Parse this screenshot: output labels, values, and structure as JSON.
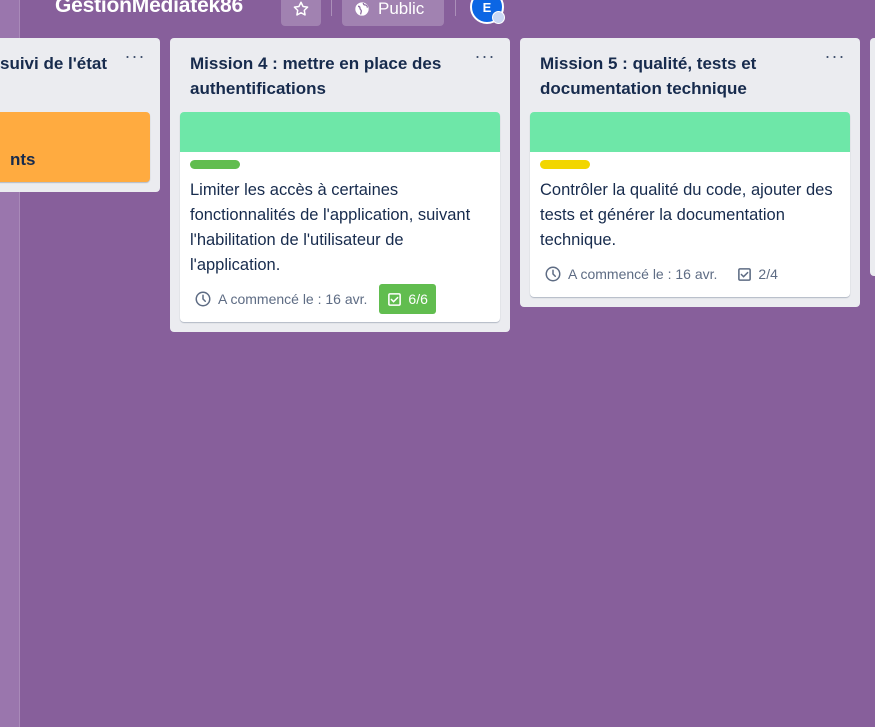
{
  "board": {
    "title": "GestionMediatek86",
    "visibility_label": "Public",
    "avatar_initial": "E"
  },
  "lists": [
    {
      "title": "suivi de l'état",
      "menu": "···",
      "cards": [
        {
          "cover_color": "#ffab40",
          "text": "nts"
        }
      ]
    },
    {
      "title": "Mission 4 : mettre en place des authentifications",
      "menu": "···",
      "cards": [
        {
          "cover_color": "#6ee7a8",
          "label_color": "#61bd4f",
          "text": "Limiter les accès à certaines fonctionnalités de l'application, suivant l'habilitation de l'utilisateur de l'application.",
          "date_badge": "A commencé le : 16 avr.",
          "checklist_badge": "6/6",
          "checklist_complete": true
        }
      ]
    },
    {
      "title": "Mission 5 : qualité, tests et documentation technique",
      "menu": "···",
      "cards": [
        {
          "cover_color": "#6ee7a8",
          "label_color": "#f2d600",
          "text": "Contrôler la qualité du code, ajouter des tests et générer la documentation technique.",
          "date_badge": "A commencé le : 16 avr.",
          "checklist_badge": "2/4",
          "checklist_complete": false
        }
      ]
    }
  ],
  "colors": {
    "board_background": "#875f9b",
    "list_background": "#ebecf0",
    "text_primary": "#172b4d",
    "complete_green": "#61bd4f",
    "avatar_blue": "#0c66e4"
  },
  "icons": {
    "star": "star-icon",
    "public": "globe-icon",
    "date": "clock-icon",
    "checklist": "checkbox-icon",
    "menu": "more-horizontal-icon"
  }
}
